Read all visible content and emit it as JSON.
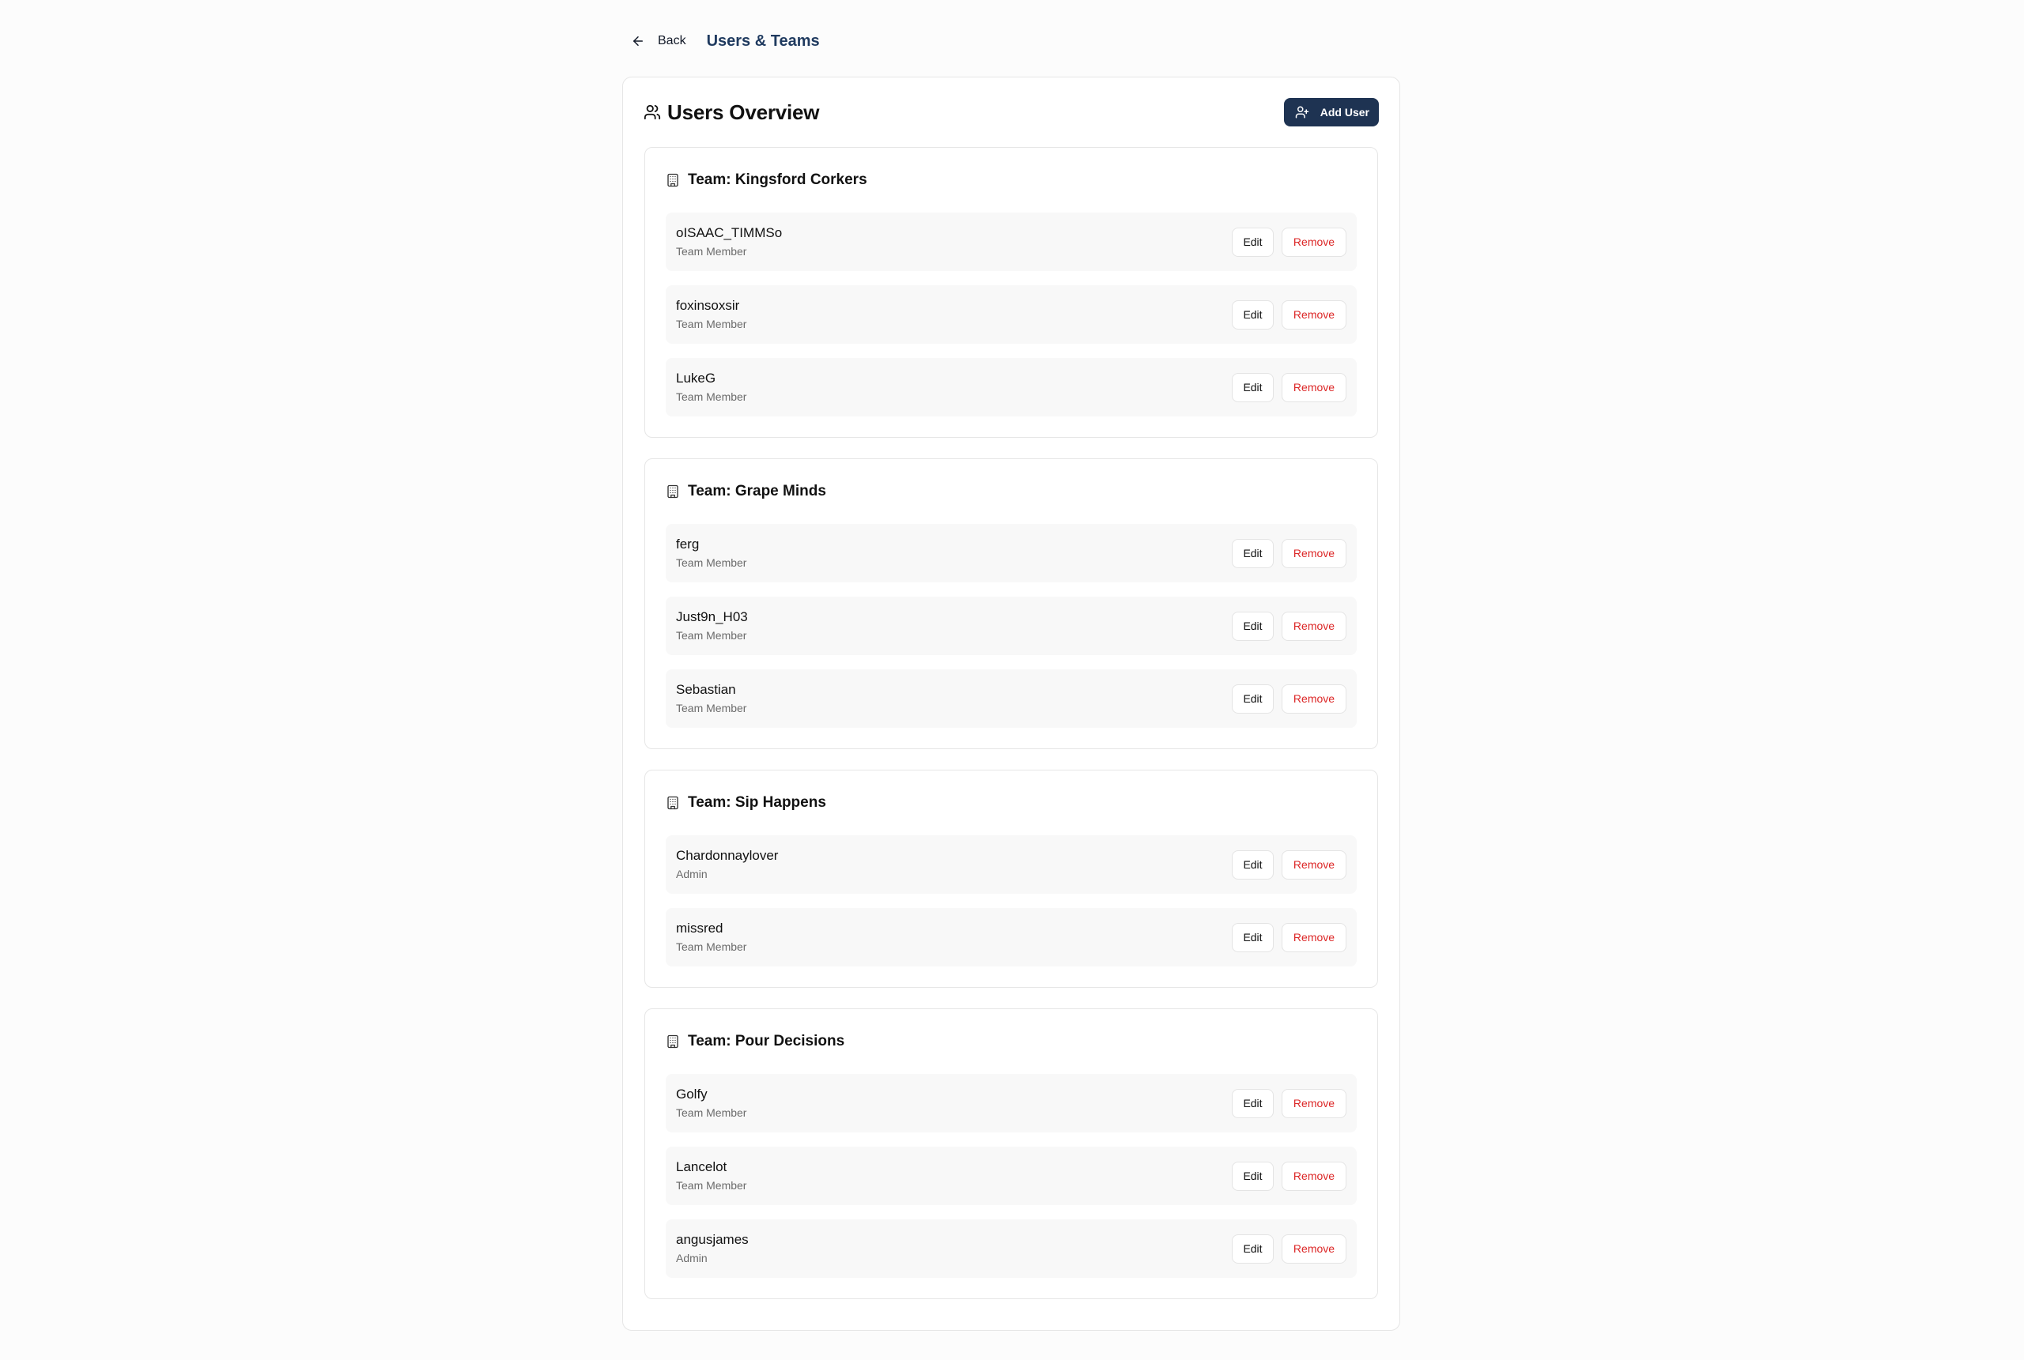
{
  "header": {
    "back_label": "Back",
    "page_title": "Users & Teams"
  },
  "overview": {
    "title": "Users Overview",
    "add_user_label": "Add User"
  },
  "actions": {
    "edit_label": "Edit",
    "remove_label": "Remove"
  },
  "colors": {
    "primary": "#1e3352",
    "page_title": "#1f3a5f",
    "danger": "#dc2626"
  },
  "icons": {
    "back": "arrow-left-icon",
    "overview": "users-icon",
    "add_user": "user-plus-icon",
    "team": "building-icon"
  },
  "teams": [
    {
      "title": "Team: Kingsford Corkers",
      "members": [
        {
          "name": "oISAAC_TIMMSo",
          "role": "Team Member"
        },
        {
          "name": "foxinsoxsir",
          "role": "Team Member"
        },
        {
          "name": "LukeG",
          "role": "Team Member"
        }
      ]
    },
    {
      "title": "Team: Grape Minds",
      "members": [
        {
          "name": "ferg",
          "role": "Team Member"
        },
        {
          "name": "Just9n_H03",
          "role": "Team Member"
        },
        {
          "name": "Sebastian",
          "role": "Team Member"
        }
      ]
    },
    {
      "title": "Team: Sip Happens",
      "members": [
        {
          "name": "Chardonnaylover",
          "role": "Admin"
        },
        {
          "name": "missred",
          "role": "Team Member"
        }
      ]
    },
    {
      "title": "Team: Pour Decisions",
      "members": [
        {
          "name": "Golfy",
          "role": "Team Member"
        },
        {
          "name": "Lancelot",
          "role": "Team Member"
        },
        {
          "name": "angusjames",
          "role": "Admin"
        }
      ]
    }
  ]
}
